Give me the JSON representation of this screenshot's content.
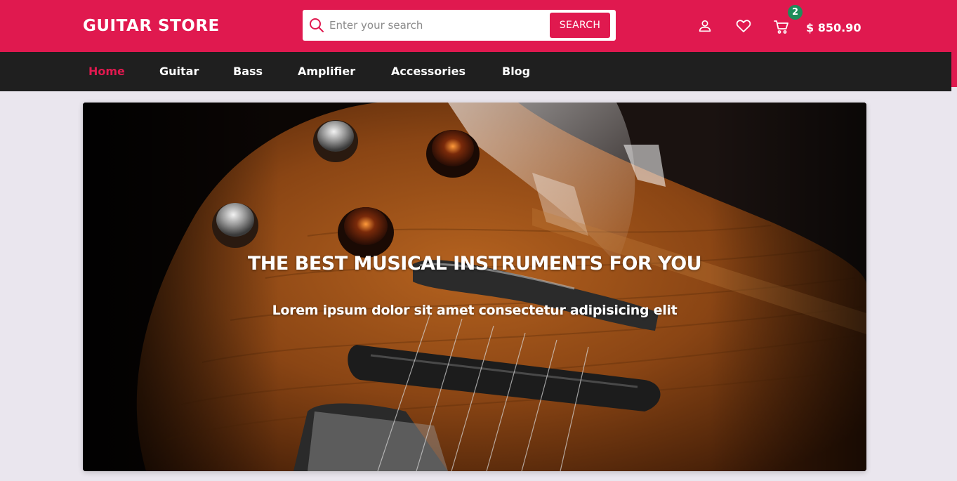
{
  "header": {
    "brand": "GUITAR STORE",
    "search_placeholder": "Enter your search",
    "search_button": "SEARCH",
    "cart_count": "2",
    "cart_total": "$ 850.90",
    "accent_color": "#e0194f",
    "badge_color": "#1e8c5a",
    "icons": [
      "search-icon",
      "user-icon",
      "heart-icon",
      "cart-icon"
    ]
  },
  "nav": {
    "items": [
      "Home",
      "Guitar",
      "Bass",
      "Amplifier",
      "Accessories",
      "Blog"
    ],
    "active": "Home",
    "background": "#1f1f1f"
  },
  "hero": {
    "title": "THE BEST MUSICAL INSTRUMENTS FOR YOU",
    "subtitle": "Lorem ipsum dolor sit amet consectetur adipisicing elit"
  }
}
